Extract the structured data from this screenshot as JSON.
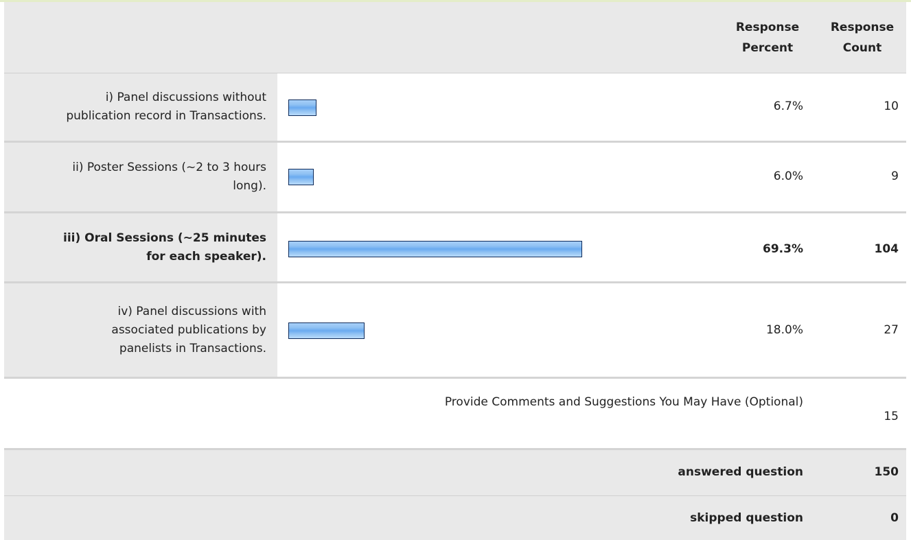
{
  "header": {
    "percent_label": [
      "Response",
      "Percent"
    ],
    "count_label": [
      "Response",
      "Count"
    ]
  },
  "rows": [
    {
      "label_lines": [
        "i) Panel discussions without",
        "publication record in Transactions."
      ],
      "percent": "6.7%",
      "count": "10",
      "fraction": 0.067
    },
    {
      "label_lines": [
        "ii) Poster Sessions (~2 to 3 hours",
        "long)."
      ],
      "percent": "6.0%",
      "count": "9",
      "fraction": 0.06
    },
    {
      "label_lines": [
        "iii) Oral Sessions (~25 minutes",
        "for each speaker)."
      ],
      "percent": "69.3%",
      "count": "104",
      "fraction": 0.693
    },
    {
      "label_lines": [
        "iv) Panel discussions with",
        "associated publications by",
        "panelists in Transactions."
      ],
      "percent": "18.0%",
      "count": "27",
      "fraction": 0.18
    }
  ],
  "comments": {
    "label": "Provide Comments and Suggestions You May Have (Optional)",
    "count": "15"
  },
  "summary": {
    "answered_label": "answered question",
    "answered_value": "150",
    "skipped_label": "skipped question",
    "skipped_value": "0"
  },
  "colors": {
    "bar_fill": "#8fc1f3",
    "bar_border": "#0d2a5a",
    "row_gray": "#e9e9e9"
  }
}
